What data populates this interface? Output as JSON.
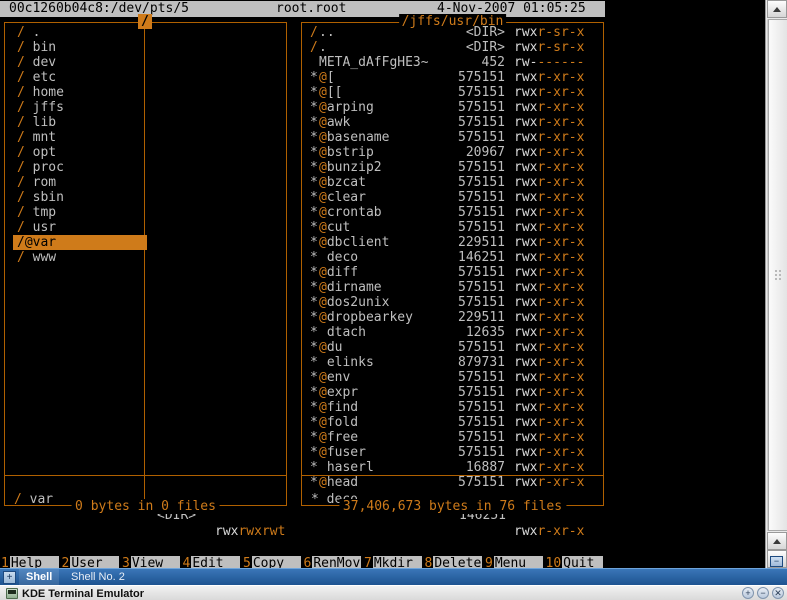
{
  "titlebar": {
    "host": "00c1260b04c8:/dev/pts/5",
    "user": "root.root",
    "clock": "4-Nov-2007 01:05:25"
  },
  "colors": {
    "panel_border": "#b06000",
    "accent_orange": "#cf7b1a",
    "text_gray": "#bfbfbf",
    "titlebar_bg": "#bfbfbf",
    "background": "#000000"
  },
  "left_panel": {
    "title": "/",
    "rows": [
      {
        "slash": "/",
        "name": "."
      },
      {
        "slash": "/",
        "name": "bin"
      },
      {
        "slash": "/",
        "name": "dev"
      },
      {
        "slash": "/",
        "name": "etc"
      },
      {
        "slash": "/",
        "name": "home"
      },
      {
        "slash": "/",
        "name": "jffs"
      },
      {
        "slash": "/",
        "name": "lib"
      },
      {
        "slash": "/",
        "name": "mnt"
      },
      {
        "slash": "/",
        "name": "opt"
      },
      {
        "slash": "/",
        "name": "proc"
      },
      {
        "slash": "/",
        "name": "rom"
      },
      {
        "slash": "/",
        "name": "sbin"
      },
      {
        "slash": "/",
        "name": "tmp"
      },
      {
        "slash": "/",
        "name": "usr"
      },
      {
        "slash": "/",
        "name": "@var",
        "selected": true
      },
      {
        "slash": "/",
        "name": "www"
      }
    ],
    "status": {
      "slash": "/",
      "name": "var",
      "size": "<DIR>",
      "perm_w": "rwx",
      "perm_o": "rwxrwt"
    },
    "totals": "0 bytes in 0 files"
  },
  "right_panel": {
    "title": "/jffs/usr/bin",
    "rows": [
      {
        "mark": "/",
        "name": "..",
        "size": "<DIR>",
        "p1": "rwx",
        "p2": "r-sr-x"
      },
      {
        "mark": "/",
        "name": ".",
        "size": "<DIR>",
        "p1": "rwx",
        "p2": "r-sr-x"
      },
      {
        "mark": "",
        "name": "META_dAfFgHE3~",
        "size": "452",
        "p1": "rw-",
        "p2": "------"
      },
      {
        "mark": "*",
        "name": "@[",
        "size": "575151",
        "p1": "rwx",
        "p2": "r-xr-x"
      },
      {
        "mark": "*",
        "name": "@[[",
        "size": "575151",
        "p1": "rwx",
        "p2": "r-xr-x"
      },
      {
        "mark": "*",
        "name": "@arping",
        "size": "575151",
        "p1": "rwx",
        "p2": "r-xr-x"
      },
      {
        "mark": "*",
        "name": "@awk",
        "size": "575151",
        "p1": "rwx",
        "p2": "r-xr-x"
      },
      {
        "mark": "*",
        "name": "@basename",
        "size": "575151",
        "p1": "rwx",
        "p2": "r-xr-x"
      },
      {
        "mark": "*",
        "name": "@bstrip",
        "size": "20967",
        "p1": "rwx",
        "p2": "r-xr-x"
      },
      {
        "mark": "*",
        "name": "@bunzip2",
        "size": "575151",
        "p1": "rwx",
        "p2": "r-xr-x"
      },
      {
        "mark": "*",
        "name": "@bzcat",
        "size": "575151",
        "p1": "rwx",
        "p2": "r-xr-x"
      },
      {
        "mark": "*",
        "name": "@clear",
        "size": "575151",
        "p1": "rwx",
        "p2": "r-xr-x"
      },
      {
        "mark": "*",
        "name": "@crontab",
        "size": "575151",
        "p1": "rwx",
        "p2": "r-xr-x"
      },
      {
        "mark": "*",
        "name": "@cut",
        "size": "575151",
        "p1": "rwx",
        "p2": "r-xr-x"
      },
      {
        "mark": "*",
        "name": "@dbclient",
        "size": "229511",
        "p1": "rwx",
        "p2": "r-xr-x"
      },
      {
        "mark": "*",
        "name": " deco",
        "size": "146251",
        "p1": "rwx",
        "p2": "r-xr-x"
      },
      {
        "mark": "*",
        "name": "@diff",
        "size": "575151",
        "p1": "rwx",
        "p2": "r-xr-x"
      },
      {
        "mark": "*",
        "name": "@dirname",
        "size": "575151",
        "p1": "rwx",
        "p2": "r-xr-x"
      },
      {
        "mark": "*",
        "name": "@dos2unix",
        "size": "575151",
        "p1": "rwx",
        "p2": "r-xr-x"
      },
      {
        "mark": "*",
        "name": "@dropbearkey",
        "size": "229511",
        "p1": "rwx",
        "p2": "r-xr-x"
      },
      {
        "mark": "*",
        "name": " dtach",
        "size": "12635",
        "p1": "rwx",
        "p2": "r-xr-x"
      },
      {
        "mark": "*",
        "name": "@du",
        "size": "575151",
        "p1": "rwx",
        "p2": "r-xr-x"
      },
      {
        "mark": "*",
        "name": " elinks",
        "size": "879731",
        "p1": "rwx",
        "p2": "r-xr-x"
      },
      {
        "mark": "*",
        "name": "@env",
        "size": "575151",
        "p1": "rwx",
        "p2": "r-xr-x"
      },
      {
        "mark": "*",
        "name": "@expr",
        "size": "575151",
        "p1": "rwx",
        "p2": "r-xr-x"
      },
      {
        "mark": "*",
        "name": "@find",
        "size": "575151",
        "p1": "rwx",
        "p2": "r-xr-x"
      },
      {
        "mark": "*",
        "name": "@fold",
        "size": "575151",
        "p1": "rwx",
        "p2": "r-xr-x"
      },
      {
        "mark": "*",
        "name": "@free",
        "size": "575151",
        "p1": "rwx",
        "p2": "r-xr-x"
      },
      {
        "mark": "*",
        "name": "@fuser",
        "size": "575151",
        "p1": "rwx",
        "p2": "r-xr-x"
      },
      {
        "mark": "*",
        "name": " haserl",
        "size": "16887",
        "p1": "rwx",
        "p2": "r-xr-x"
      },
      {
        "mark": "*",
        "name": "@head",
        "size": "575151",
        "p1": "rwx",
        "p2": "r-xr-x"
      }
    ],
    "status": {
      "mark": "*",
      "name": "deco",
      "size": "146251",
      "p1": "rwx",
      "p2": "r-xr-x"
    },
    "totals": "37,406,673 bytes in 76 files"
  },
  "prompt": {
    "path": "/",
    "symbol": ">",
    "command": ""
  },
  "fkeys": [
    {
      "num": "1",
      "label": "Help"
    },
    {
      "num": "2",
      "label": "User"
    },
    {
      "num": "3",
      "label": "View"
    },
    {
      "num": "4",
      "label": "Edit"
    },
    {
      "num": "5",
      "label": "Copy"
    },
    {
      "num": "6",
      "label": "RenMov"
    },
    {
      "num": "7",
      "label": "Mkdir"
    },
    {
      "num": "8",
      "label": "Delete"
    },
    {
      "num": "9",
      "label": "Menu"
    },
    {
      "num": "10",
      "label": "Quit"
    }
  ],
  "taskbar": {
    "new_tab_label": "+",
    "tabs": [
      {
        "label": "Shell",
        "active": true
      },
      {
        "label": "Shell No. 2",
        "active": false
      }
    ],
    "task_button": "KDE Terminal Emulator",
    "mini_buttons": [
      "+",
      "−",
      "✕"
    ],
    "window_minimize": "−"
  }
}
